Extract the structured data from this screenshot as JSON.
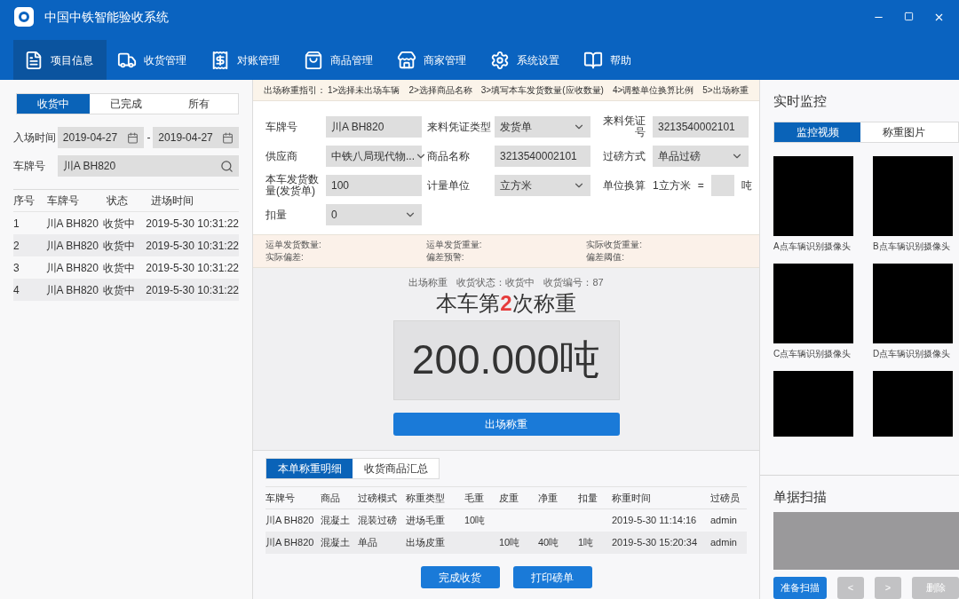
{
  "window": {
    "title": "中国中铁智能验收系统"
  },
  "nav": [
    {
      "label": "项目信息",
      "selected": true
    },
    {
      "label": "收货管理",
      "selected": false
    },
    {
      "label": "对账管理",
      "selected": false
    },
    {
      "label": "商品管理",
      "selected": false
    },
    {
      "label": "商家管理",
      "selected": false
    },
    {
      "label": "系统设置",
      "selected": false
    },
    {
      "label": "帮助",
      "selected": false
    }
  ],
  "status_tabs": [
    {
      "label": "收货中",
      "selected": true
    },
    {
      "label": "已完成",
      "selected": false
    },
    {
      "label": "所有",
      "selected": false
    }
  ],
  "date_filter": {
    "label": "入场时间",
    "from": "2019-04-27",
    "separator": "-",
    "to": "2019-04-27"
  },
  "plate_filter": {
    "label": "车牌号",
    "value": "川A BH820"
  },
  "vehicle_table": {
    "columns": [
      "序号",
      "车牌号",
      "状态",
      "进场时间"
    ],
    "rows": [
      {
        "cells": [
          "1",
          "川A BH820",
          "收货中",
          "2019-5-30 10:31:22"
        ]
      },
      {
        "cells": [
          "2",
          "川A BH820",
          "收货中",
          "2019-5-30 10:31:22"
        ]
      },
      {
        "cells": [
          "3",
          "川A BH820",
          "收货中",
          "2019-5-30 10:31:22"
        ]
      },
      {
        "cells": [
          "4",
          "川A BH820",
          "收货中",
          "2019-5-30 10:31:22"
        ]
      }
    ]
  },
  "guide": {
    "title": "出场称重指引：",
    "steps": [
      "1>选择未出场车辆",
      "2>选择商品名称",
      "3>填写本车发货数量(应收数量)",
      "4>调整单位换算比例",
      "5>出场称重"
    ]
  },
  "form": [
    {
      "label": "车牌号",
      "kind": "text",
      "value": "川A BH820"
    },
    {
      "label": "来料凭证类型",
      "kind": "select",
      "value": "发货单"
    },
    {
      "label": "来料凭证号",
      "kind": "text",
      "value": "3213540002101"
    },
    {
      "label": "供应商",
      "kind": "select",
      "value": "中铁八局现代物..."
    },
    {
      "label": "商品名称",
      "kind": "text",
      "value": "3213540002101"
    },
    {
      "label": "过磅方式",
      "kind": "select",
      "value": "单品过磅"
    },
    {
      "label": "本车发货数量(发货单)",
      "kind": "text",
      "value": "100"
    },
    {
      "label": "计量单位",
      "kind": "select",
      "value": "立方米"
    },
    {
      "label": "单位换算",
      "kind": "conversion",
      "value": "1立方米",
      "equals": "=",
      "unit": "吨"
    },
    {
      "label": "扣量",
      "kind": "select",
      "value": "0"
    }
  ],
  "summary": [
    "运单发货数量:",
    "运单发货重量:",
    "实际收货重量:",
    "实际偏差:",
    "偏差预警:",
    "偏差阈值:"
  ],
  "weigh": {
    "info": [
      "出场称重",
      "收货状态：收货中",
      "收货编号：87"
    ],
    "heading_before": "本车第",
    "count": "2",
    "heading_after": "次称重",
    "reading": "200.000吨",
    "button": "出场称重"
  },
  "detail_tabs": [
    {
      "label": "本单称重明细",
      "selected": true
    },
    {
      "label": "收货商品汇总",
      "selected": false
    }
  ],
  "detail_table": {
    "columns": [
      "车牌号",
      "商品",
      "过磅模式",
      "称重类型",
      "毛重",
      "皮重",
      "净重",
      "扣量",
      "称重时间",
      "过磅员"
    ],
    "rows": [
      {
        "cells": [
          "川A BH820",
          "混凝土",
          "混装过磅",
          "进场毛重",
          "10吨",
          "",
          "",
          "",
          "2019-5-30 11:14:16",
          "admin"
        ]
      },
      {
        "cells": [
          "川A BH820",
          "混凝土",
          "单品",
          "出场皮重",
          "",
          "10吨",
          "40吨",
          "1吨",
          "2019-5-30 15:20:34",
          "admin"
        ]
      }
    ]
  },
  "actions": [
    "完成收货",
    "打印磅单"
  ],
  "monitor": {
    "title": "实时监控",
    "tabs": [
      {
        "label": "监控视频",
        "selected": true
      },
      {
        "label": "称重图片",
        "selected": false
      }
    ],
    "cameras": [
      {
        "kind": "labeled",
        "label": "A点车辆识别摄像头"
      },
      {
        "kind": "labeled",
        "label": "B点车辆识别摄像头"
      },
      {
        "kind": "labeled",
        "label": "C点车辆识别摄像头"
      },
      {
        "kind": "labeled",
        "label": "D点车辆识别摄像头"
      },
      {
        "kind": "unlabeled"
      },
      {
        "kind": "unlabeled"
      }
    ]
  },
  "scan": {
    "title": "单据扫描",
    "buttons": [
      {
        "label": "准备扫描",
        "disabled": false
      },
      {
        "label": "<",
        "disabled": true
      },
      {
        "label": ">",
        "disabled": true
      },
      {
        "label": "删除",
        "disabled": true
      }
    ]
  }
}
